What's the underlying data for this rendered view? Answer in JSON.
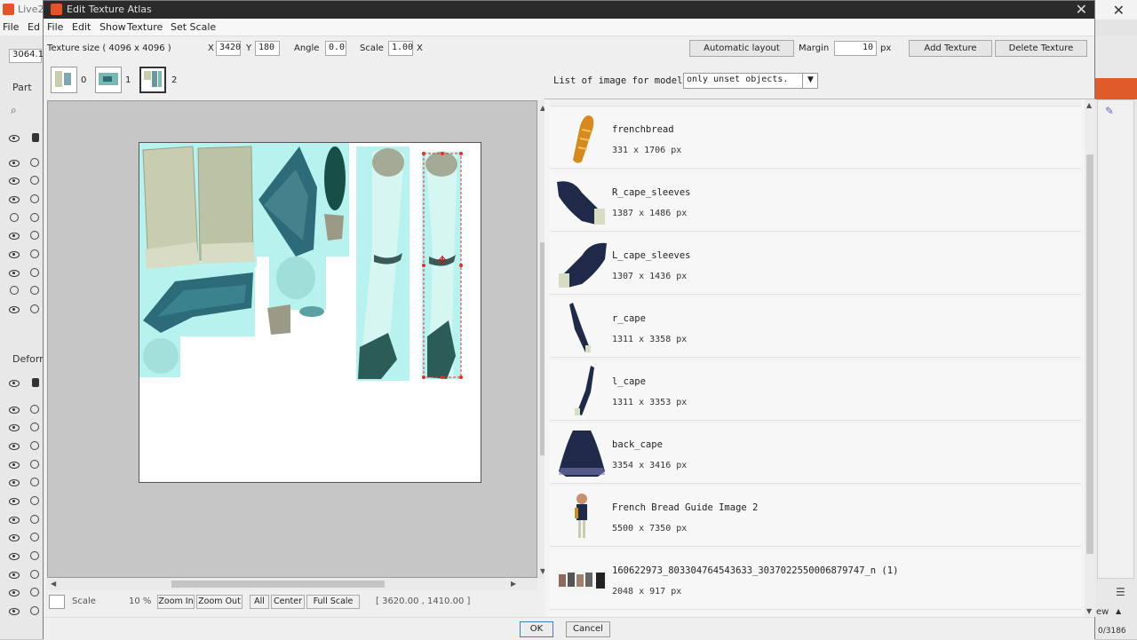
{
  "background_app": {
    "title": "Live2",
    "menu": [
      "File",
      "Ed"
    ],
    "field_value": "3064.1",
    "part_label": "Part",
    "deform_label": "Deforn",
    "right_label": "ew",
    "corner_text": "0/3186"
  },
  "dialog": {
    "title": "Edit Texture Atlas",
    "menu": [
      "File",
      "Edit",
      "Show",
      "Texture",
      "Set Scale"
    ]
  },
  "toolbar": {
    "texture_size_label": "Texture size ( 4096 x 4096 )",
    "x_label": "X",
    "x_value": "3420",
    "y_label": "Y",
    "y_value": "180",
    "angle_label": "Angle",
    "angle_value": "0.0",
    "scale_label": "Scale",
    "scale_value": "1.00",
    "scale_unit": "X",
    "auto_layout": "Automatic layout",
    "margin_label": "Margin",
    "margin_value": "10",
    "margin_unit": "px",
    "add_texture": "Add Texture",
    "delete_texture": "Delete Texture"
  },
  "pages": [
    {
      "num": "0"
    },
    {
      "num": "1"
    },
    {
      "num": "2"
    }
  ],
  "status": {
    "scale_label": "Scale",
    "scale_value": "10 %",
    "zoom_in": "Zoom In",
    "zoom_out": "Zoom Out",
    "all": "All",
    "center": "Center",
    "full_scale": "Full Scale",
    "coords": "[ 3620.00 , 1410.00 ]"
  },
  "list": {
    "label": "List of image for model.",
    "filter_value": "only unset objects.",
    "items": [
      {
        "name": "frenchbread",
        "size": "331 x 1706 px"
      },
      {
        "name": "R_cape_sleeves",
        "size": "1387 x 1486 px"
      },
      {
        "name": "L_cape_sleeves",
        "size": "1307 x 1436 px"
      },
      {
        "name": "r_cape",
        "size": "1311 x 3358 px"
      },
      {
        "name": "l_cape",
        "size": "1311 x 3353 px"
      },
      {
        "name": "back_cape",
        "size": "3354 x 3416 px"
      },
      {
        "name": "French Bread Guide Image 2",
        "size": "5500 x 7350 px"
      },
      {
        "name": "160622973_803304764543633_3037022550006879747_n (1)",
        "size": "2048 x 917 px"
      }
    ]
  },
  "footer": {
    "ok": "OK",
    "cancel": "Cancel"
  },
  "colors": {
    "texture_teal": "#2c6c78",
    "texture_cyan_bg": "#b8f2ee",
    "texture_beige": "#c8cdb0",
    "selection_red": "#e03030",
    "cape_navy": "#1f2a48"
  }
}
